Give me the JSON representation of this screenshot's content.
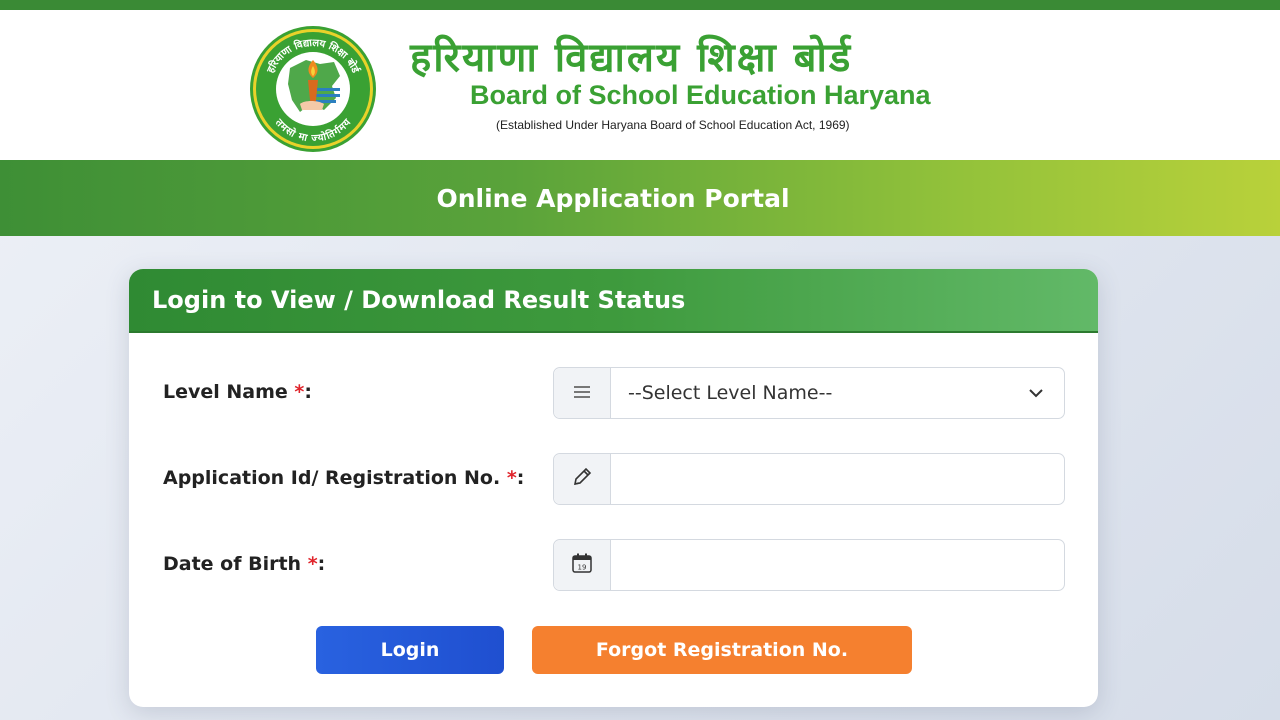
{
  "header": {
    "title_hindi": "हरियाणा विद्यालय शिक्षा बोर्ड",
    "title_english": "Board of School Education Haryana",
    "subtitle": "(Established Under Haryana Board of School Education Act, 1969)",
    "logo": {
      "ring_text_top": "हरियाणा विद्यालय शिक्षा बोर्ड",
      "ring_text_bottom": "तमसो मा ज्योतिर्गमय"
    }
  },
  "banner": {
    "title": "Online Application Portal"
  },
  "form": {
    "title": "Login to View / Download Result Status",
    "fields": [
      {
        "label": "Level Name ",
        "required_mark": "*",
        "colon": ":",
        "icon": "list-icon",
        "value": "--Select Level Name--"
      },
      {
        "label": "Application Id/ Registration No. ",
        "required_mark": "*",
        "colon": ":",
        "icon": "pencil-icon",
        "value": ""
      },
      {
        "label": "Date of Birth ",
        "required_mark": "*",
        "colon": ":",
        "icon": "calendar-icon",
        "calendar_day": "19",
        "value": ""
      }
    ],
    "login_label": "Login",
    "forgot_label": "Forgot Registration No."
  },
  "colors": {
    "brand_green": "#3aa133",
    "top_strip": "#3a8a35",
    "login_blue": "#2962e0",
    "forgot_orange": "#f5802f",
    "required_red": "#e0242b"
  }
}
